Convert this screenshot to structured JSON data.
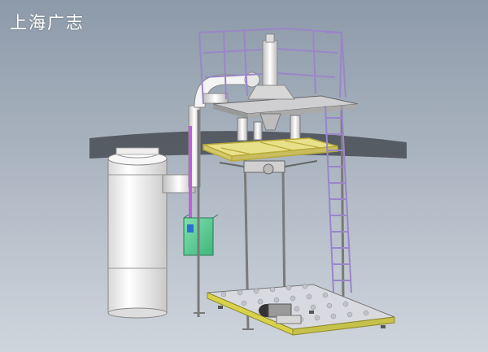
{
  "watermark": {
    "text": "上海广志"
  },
  "colors": {
    "background_top": "#8d9aa9",
    "background_bottom": "#c9d0d9",
    "frame": "#7a7a7a",
    "railing": "#9a86c8",
    "yellow_frame": "#e9e08a",
    "control_box": "#5fcf96",
    "conveyor_edge": "#d7d24a",
    "tank": "#f2f2f2"
  }
}
